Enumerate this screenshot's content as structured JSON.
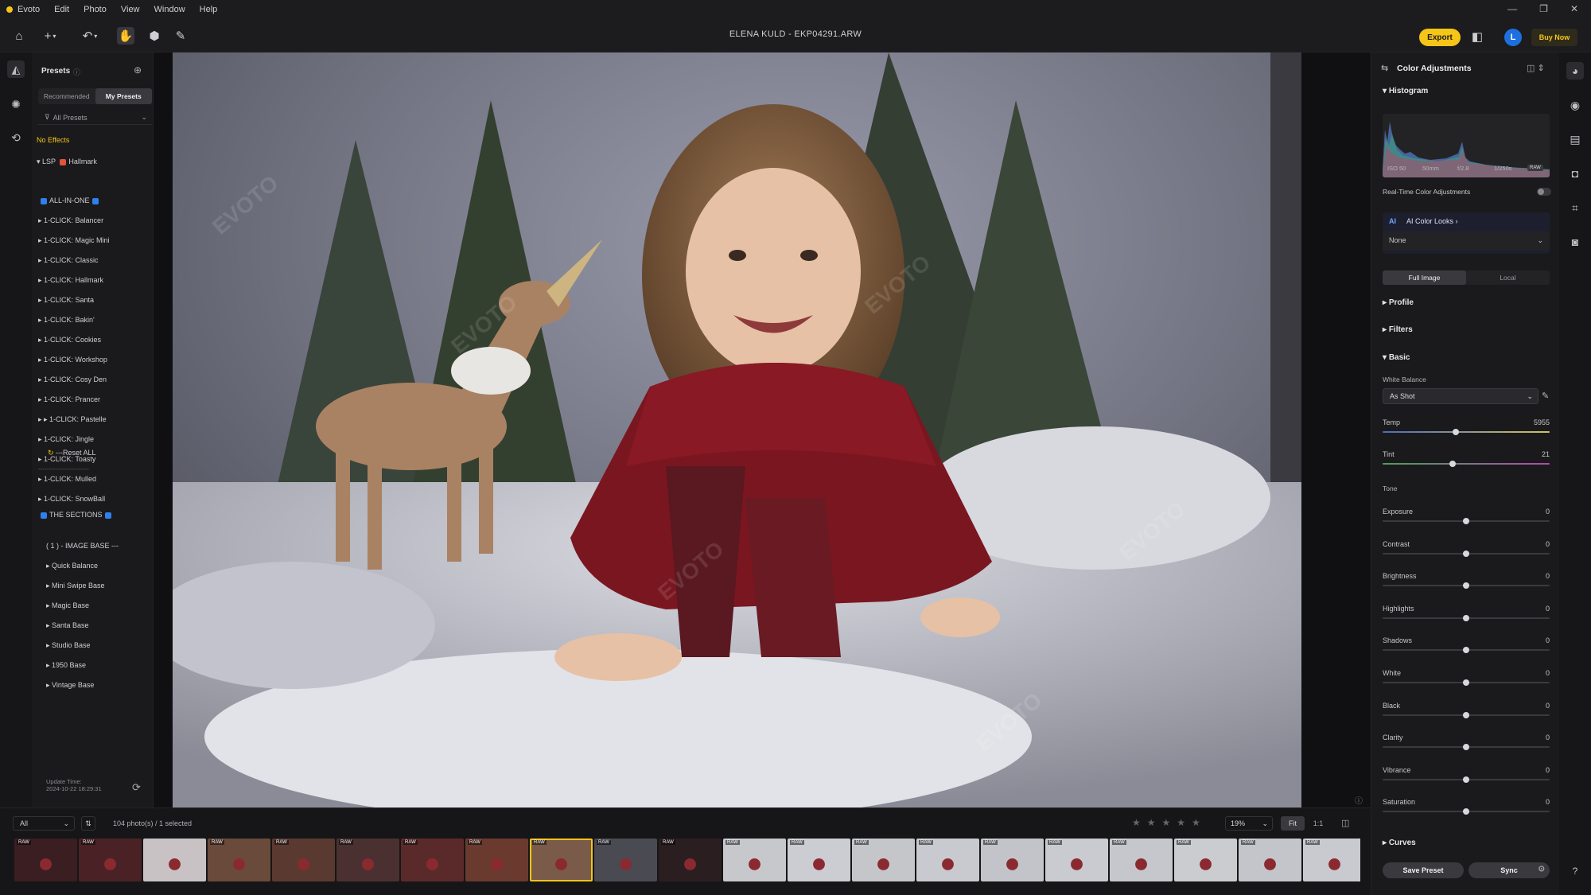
{
  "menubar": {
    "app_name": "Evoto",
    "items": [
      "Edit",
      "Photo",
      "View",
      "Window",
      "Help"
    ]
  },
  "toolbar": {
    "document_title": "ELENA KULD - EKP04291.ARW",
    "export_label": "Export",
    "avatar_letter": "L",
    "buy_label": "Buy Now"
  },
  "presets": {
    "title": "Presets",
    "tabs": [
      "Recommended",
      "My Presets"
    ],
    "active_tab": "My Presets",
    "filter_label": "All Presets",
    "no_effects": "No Effects",
    "group_label": "LSP",
    "group_name": "Hallmark",
    "all_in_one": "ALL-IN-ONE",
    "items_one_click": [
      "1-CLICK: Balancer",
      "1-CLICK: Magic Mini",
      "1-CLICK: Classic",
      "1-CLICK: Hallmark",
      "1-CLICK: Santa",
      "1-CLICK: Bakin'",
      "1-CLICK: Cookies",
      "1-CLICK: Workshop",
      "1-CLICK: Cosy Den",
      "1-CLICK: Prancer",
      "1-CLICK: Pastelle",
      "1-CLICK: Jingle",
      "1-CLICK: Toasty",
      "1-CLICK: Mulled",
      "1-CLICK: SnowBall"
    ],
    "reset_all": "---Reset ALL",
    "divider": "------------------------",
    "the_sections": "THE SECTIONS",
    "image_base": "( 1 ) - IMAGE BASE ---",
    "items_sections": [
      "Quick Balance",
      "Mini Swipe Base",
      "Magic Base",
      "Santa Base",
      "Studio Base",
      "1950 Base",
      "Vintage Base"
    ],
    "update_label": "Update Time:",
    "update_time": "2024-10-22 18:29:31"
  },
  "filmstrip": {
    "filter_value": "All",
    "count_text": "104 photo(s) / 1 selected",
    "zoom_value": "19%",
    "fit_label": "Fit",
    "one_to_one_label": "1:1",
    "raw_badge": "RAW",
    "selected_index": 8
  },
  "adjustments": {
    "title": "Color Adjustments",
    "histogram_label": "Histogram",
    "exif": {
      "iso": "ISO 50",
      "focal": "50mm",
      "aperture": "f/2.8",
      "shutter": "1/250s",
      "raw": "RAW"
    },
    "realtime_label": "Real-Time Color Adjustments",
    "ai_looks_label": "AI Color Looks",
    "ai_looks_value": "None",
    "scope_tabs": [
      "Full Image",
      "Local"
    ],
    "sections": {
      "profile": "Profile",
      "filters": "Filters",
      "basic": "Basic",
      "curves": "Curves"
    },
    "white_balance_label": "White Balance",
    "white_balance_value": "As Shot",
    "tone_label": "Tone",
    "temp": {
      "label": "Temp",
      "value": "5955",
      "level": 0.44
    },
    "tint": {
      "label": "Tint",
      "value": "21",
      "level": 0.42
    },
    "tone_sliders": [
      {
        "label": "Exposure",
        "value": "0"
      },
      {
        "label": "Contrast",
        "value": "0"
      },
      {
        "label": "Brightness",
        "value": "0"
      },
      {
        "label": "Highlights",
        "value": "0"
      },
      {
        "label": "Shadows",
        "value": "0"
      },
      {
        "label": "White",
        "value": "0"
      },
      {
        "label": "Black",
        "value": "0"
      },
      {
        "label": "Clarity",
        "value": "0"
      },
      {
        "label": "Vibrance",
        "value": "0"
      },
      {
        "label": "Saturation",
        "value": "0"
      }
    ],
    "save_preset_label": "Save Preset",
    "sync_label": "Sync"
  },
  "colors": {
    "accent": "#f5c518",
    "brand_blue": "#1e6fe0"
  }
}
